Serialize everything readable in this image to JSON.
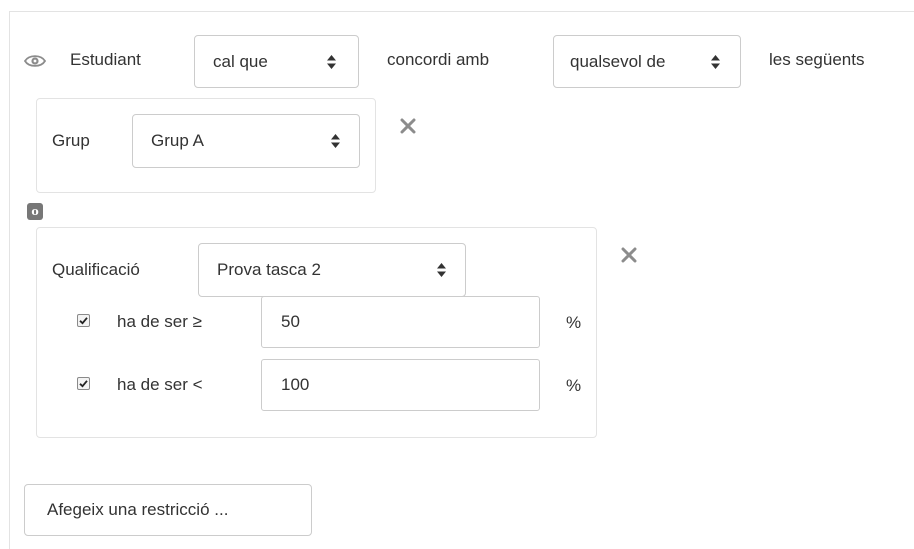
{
  "header": {
    "subject_label": "Estudiant",
    "must_select": "cal que",
    "match_label": "concordi amb",
    "match_select": "qualsevol de",
    "following_label": "les següents"
  },
  "group_condition": {
    "label": "Grup",
    "value": "Grup A"
  },
  "operator_badge": "o",
  "grade_condition": {
    "label": "Qualificació",
    "value": "Prova tasca 2",
    "min_label": "ha de ser ≥",
    "min_value": "50",
    "min_checked": true,
    "max_label": "ha de ser <",
    "max_value": "100",
    "max_checked": true,
    "unit": "%"
  },
  "add_button_label": "Afegeix una restricció ...",
  "icons": {
    "visibility": "eye-icon",
    "remove": "close-icon",
    "select_caret": "sort-caret-icon",
    "checkbox": "check-icon"
  },
  "colors": {
    "text": "#333333",
    "border": "#cccccc",
    "panel_border": "#e3e3e3",
    "icon_gray": "#8c8c8c",
    "badge_bg": "#777777"
  }
}
